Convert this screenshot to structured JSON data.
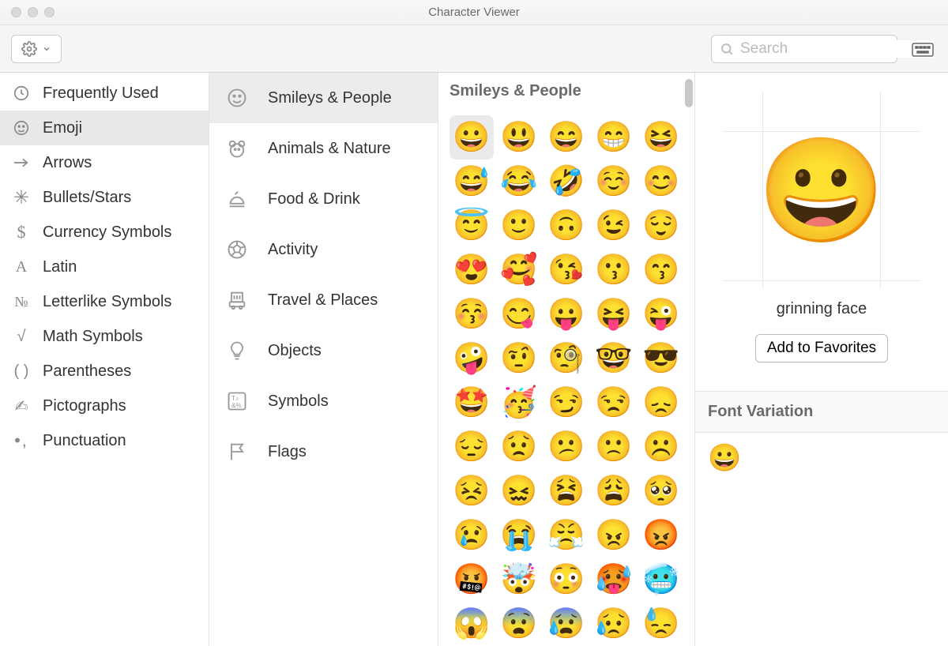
{
  "window_title": "Character Viewer",
  "search_placeholder": "Search",
  "sidebar_left": [
    {
      "label": "Frequently Used",
      "icon": "clock"
    },
    {
      "label": "Emoji",
      "icon": "smiley",
      "selected": true
    },
    {
      "label": "Arrows",
      "icon": "arrow"
    },
    {
      "label": "Bullets/Stars",
      "icon": "asterisk"
    },
    {
      "label": "Currency Symbols",
      "icon": "dollar"
    },
    {
      "label": "Latin",
      "icon": "latin"
    },
    {
      "label": "Letterlike Symbols",
      "icon": "numero"
    },
    {
      "label": "Math Symbols",
      "icon": "sqrt"
    },
    {
      "label": "Parentheses",
      "icon": "parens"
    },
    {
      "label": "Pictographs",
      "icon": "picto"
    },
    {
      "label": "Punctuation",
      "icon": "punct"
    }
  ],
  "sidebar_mid": [
    {
      "label": "Smileys & People",
      "icon": "smiley",
      "selected": true
    },
    {
      "label": "Animals & Nature",
      "icon": "bear"
    },
    {
      "label": "Food & Drink",
      "icon": "food"
    },
    {
      "label": "Activity",
      "icon": "ball"
    },
    {
      "label": "Travel & Places",
      "icon": "travel"
    },
    {
      "label": "Objects",
      "icon": "bulb"
    },
    {
      "label": "Symbols",
      "icon": "symbols"
    },
    {
      "label": "Flags",
      "icon": "flag"
    }
  ],
  "grid_header": "Smileys & People",
  "emoji_grid": [
    "😀",
    "😃",
    "😄",
    "😁",
    "😆",
    "😅",
    "😂",
    "🤣",
    "☺️",
    "😊",
    "😇",
    "🙂",
    "🙃",
    "😉",
    "😌",
    "😍",
    "🥰",
    "😘",
    "😗",
    "😙",
    "😚",
    "😋",
    "😛",
    "😝",
    "😜",
    "🤪",
    "🤨",
    "🧐",
    "🤓",
    "😎",
    "🤩",
    "🥳",
    "😏",
    "😒",
    "😞",
    "😔",
    "😟",
    "😕",
    "🙁",
    "☹️",
    "😣",
    "😖",
    "😫",
    "😩",
    "🥺",
    "😢",
    "😭",
    "😤",
    "😠",
    "😡",
    "🤬",
    "🤯",
    "😳",
    "🥵",
    "🥶",
    "😱",
    "😨",
    "😰",
    "😥",
    "😓"
  ],
  "selected_emoji_index": 0,
  "preview": {
    "glyph": "😀",
    "label": "grinning face",
    "add_button": "Add to Favorites"
  },
  "variation": {
    "header": "Font Variation",
    "swatch": "😀"
  }
}
